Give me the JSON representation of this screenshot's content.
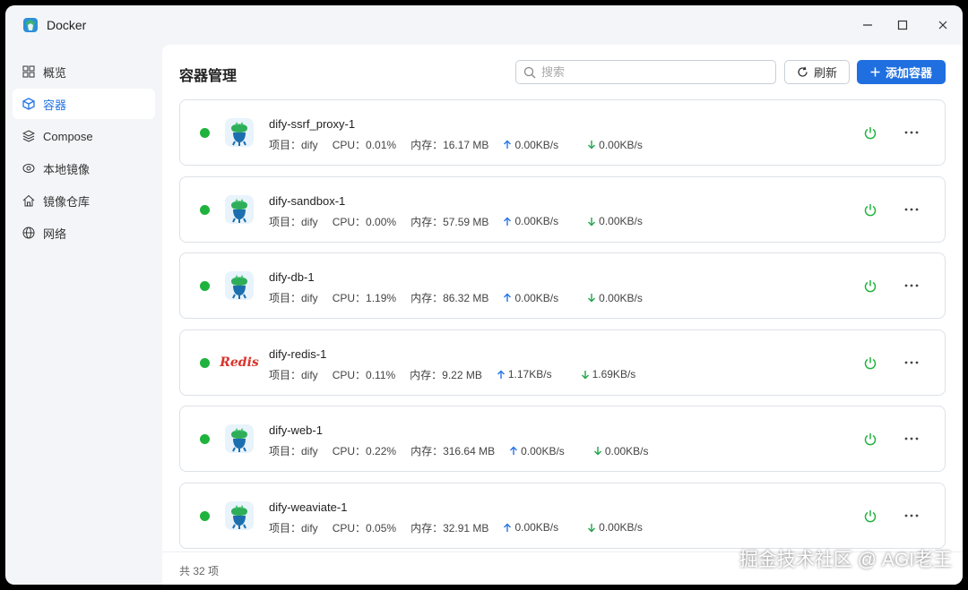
{
  "window": {
    "title": "Docker",
    "controls": {
      "minimize": "–",
      "maximize": "☐",
      "close": "✕"
    }
  },
  "sidebar": {
    "items": [
      {
        "label": "概览",
        "icon": "grid-icon",
        "active": false
      },
      {
        "label": "容器",
        "icon": "box-icon",
        "active": true
      },
      {
        "label": "Compose",
        "icon": "layers-icon",
        "active": false
      },
      {
        "label": "本地镜像",
        "icon": "eye-disc-icon",
        "active": false
      },
      {
        "label": "镜像仓库",
        "icon": "home-icon",
        "active": false
      },
      {
        "label": "网络",
        "icon": "globe-icon",
        "active": false
      }
    ]
  },
  "header": {
    "title": "容器管理",
    "search_placeholder": "搜索",
    "refresh_label": "刷新",
    "add_label": "添加容器"
  },
  "containers": [
    {
      "name": "dify-ssrf_proxy-1",
      "project": "项目：dify",
      "cpu": "CPU：0.01%",
      "mem": "内存：16.17 MB",
      "up": "0.00KB/s",
      "down": "0.00KB/s",
      "logo": "squid"
    },
    {
      "name": "dify-sandbox-1",
      "project": "项目：dify",
      "cpu": "CPU：0.00%",
      "mem": "内存：57.59 MB",
      "up": "0.00KB/s",
      "down": "0.00KB/s",
      "logo": "squid"
    },
    {
      "name": "dify-db-1",
      "project": "项目：dify",
      "cpu": "CPU：1.19%",
      "mem": "内存：86.32 MB",
      "up": "0.00KB/s",
      "down": "0.00KB/s",
      "logo": "squid"
    },
    {
      "name": "dify-redis-1",
      "project": "项目：dify",
      "cpu": "CPU：0.11%",
      "mem": "内存：9.22 MB",
      "up": "1.17KB/s",
      "down": "1.69KB/s",
      "logo": "redis"
    },
    {
      "name": "dify-web-1",
      "project": "项目：dify",
      "cpu": "CPU：0.22%",
      "mem": "内存：316.64 MB",
      "up": "0.00KB/s",
      "down": "0.00KB/s",
      "logo": "squid"
    },
    {
      "name": "dify-weaviate-1",
      "project": "项目：dify",
      "cpu": "CPU：0.05%",
      "mem": "内存：32.91 MB",
      "up": "0.00KB/s",
      "down": "0.00KB/s",
      "logo": "squid"
    }
  ],
  "redis_logo_text": "Redis",
  "footer": {
    "total": "共 32 项"
  },
  "watermark": "掘金技术社区 @ AGI老王",
  "colors": {
    "accent": "#1f6fe0",
    "running": "#1fb33d",
    "up_arrow": "#2474e5",
    "down_arrow": "#1fa34a",
    "power": "#1fb33d"
  }
}
